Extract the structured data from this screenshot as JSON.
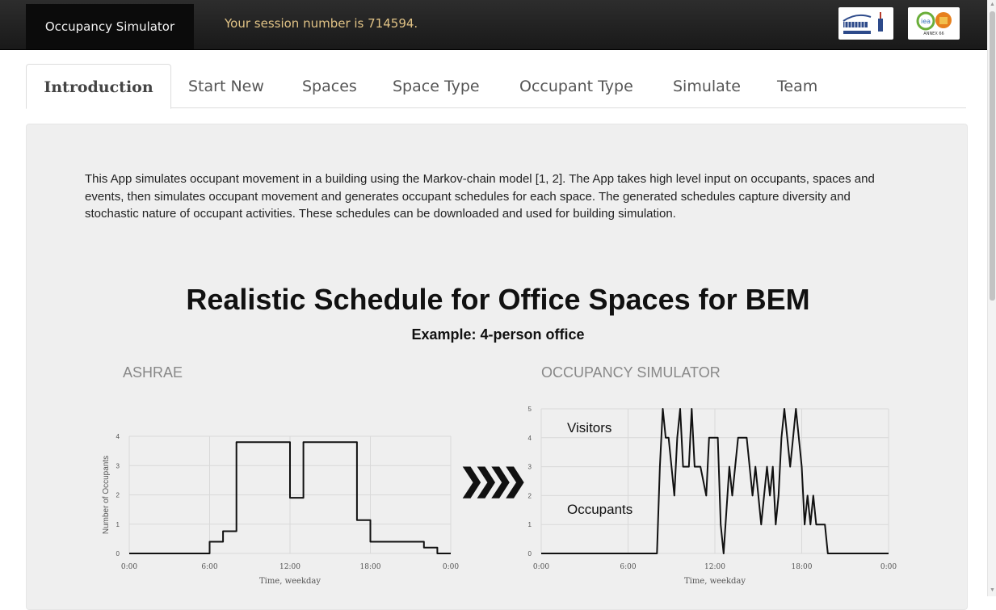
{
  "navbar": {
    "brand": "Occupancy Simulator",
    "session_text": "Your session number is 714594.",
    "logos": [
      "berkeley-lab-logo",
      "iea-annex-66-logo"
    ],
    "logo_text": [
      "BERKELEY LAB",
      "ANNEX 66"
    ]
  },
  "tabs": [
    "Introduction",
    "Start New",
    "Spaces",
    "Space Type",
    "Occupant Type",
    "Simulate",
    "Team"
  ],
  "active_tab": "Introduction",
  "intro_text": "This App simulates occupant movement in a building using the Markov-chain model [1, 2]. The App takes high level input on occupants, spaces and events, then simulates occupant movement and generates occupant schedules for each space. The generated schedules capture diversity and stochastic nature of occupant activities. These schedules can be downloaded and used for building simulation.",
  "figure": {
    "title": "Realistic Schedule for Office Spaces for BEM",
    "subtitle": "Example: 4-person office",
    "left_label": "ASHRAE",
    "right_label": "OCCUPANCY SIMULATOR",
    "arrow_glyph": "❯❯❯❯"
  },
  "chart_data": [
    {
      "type": "line",
      "title": "ASHRAE",
      "xlabel": "Time, weekday",
      "ylabel": "Number of Occupants",
      "xlim": [
        0,
        24
      ],
      "ylim": [
        0,
        4
      ],
      "x_ticks": [
        "0:00",
        "6:00",
        "12:00",
        "18:00",
        "0:00"
      ],
      "y_ticks": [
        "0",
        "1",
        "2",
        "3",
        "4"
      ],
      "step_data": [
        [
          0,
          0
        ],
        [
          6,
          0
        ],
        [
          6,
          0.4
        ],
        [
          7,
          0.4
        ],
        [
          7,
          0.76
        ],
        [
          8,
          0.76
        ],
        [
          8,
          3.8
        ],
        [
          12,
          3.8
        ],
        [
          12,
          1.9
        ],
        [
          13,
          1.9
        ],
        [
          13,
          3.8
        ],
        [
          17,
          3.8
        ],
        [
          17,
          1.14
        ],
        [
          18,
          1.14
        ],
        [
          18,
          0.4
        ],
        [
          22,
          0.4
        ],
        [
          22,
          0.2
        ],
        [
          23,
          0.2
        ],
        [
          23,
          0
        ],
        [
          24,
          0
        ]
      ]
    },
    {
      "type": "line",
      "title": "OCCUPANCY SIMULATOR",
      "xlabel": "Time, weekday",
      "ylabel": "",
      "xlim": [
        0,
        24
      ],
      "ylim": [
        0,
        5
      ],
      "x_ticks": [
        "0:00",
        "6:00",
        "12:00",
        "18:00",
        "0:00"
      ],
      "y_ticks": [
        "0",
        "1",
        "2",
        "3",
        "4",
        "5"
      ],
      "annotations": [
        "Visitors",
        "Occupants"
      ],
      "points": [
        [
          0,
          0
        ],
        [
          8,
          0
        ],
        [
          8.2,
          3
        ],
        [
          8.4,
          5
        ],
        [
          8.6,
          4
        ],
        [
          8.8,
          4
        ],
        [
          9,
          3
        ],
        [
          9.2,
          2
        ],
        [
          9.4,
          4
        ],
        [
          9.6,
          5
        ],
        [
          9.8,
          3
        ],
        [
          10.2,
          3
        ],
        [
          10.4,
          5
        ],
        [
          10.6,
          3
        ],
        [
          11,
          3
        ],
        [
          11.4,
          2
        ],
        [
          11.6,
          4
        ],
        [
          12.2,
          4
        ],
        [
          12.4,
          1
        ],
        [
          12.6,
          0
        ],
        [
          13,
          3
        ],
        [
          13.2,
          2
        ],
        [
          13.4,
          3
        ],
        [
          13.6,
          4
        ],
        [
          14.2,
          4
        ],
        [
          14.4,
          3
        ],
        [
          14.6,
          2
        ],
        [
          14.8,
          3
        ],
        [
          15,
          2
        ],
        [
          15.2,
          1
        ],
        [
          15.4,
          2
        ],
        [
          15.6,
          3
        ],
        [
          15.8,
          2
        ],
        [
          16,
          3
        ],
        [
          16.2,
          1
        ],
        [
          16.4,
          2
        ],
        [
          16.6,
          4
        ],
        [
          16.8,
          5
        ],
        [
          17,
          4
        ],
        [
          17.2,
          3
        ],
        [
          17.4,
          4
        ],
        [
          17.6,
          5
        ],
        [
          17.8,
          4
        ],
        [
          18,
          3
        ],
        [
          18.2,
          1
        ],
        [
          18.4,
          2
        ],
        [
          18.6,
          1
        ],
        [
          18.8,
          2
        ],
        [
          19,
          1
        ],
        [
          19.6,
          1
        ],
        [
          19.8,
          0
        ],
        [
          24,
          0
        ]
      ]
    }
  ]
}
